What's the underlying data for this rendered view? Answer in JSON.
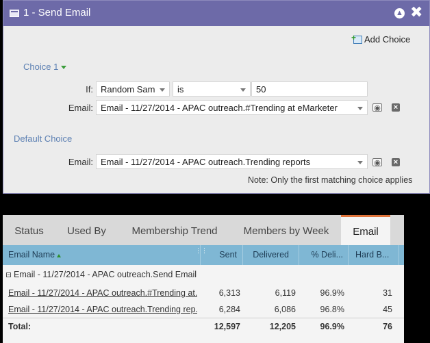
{
  "dialog": {
    "title": "1 - Send Email",
    "add_choice_label": "Add Choice",
    "choice1": {
      "label": "Choice 1",
      "if_label": "If:",
      "condition_field": "Random Sam",
      "operator": "is",
      "value": "50",
      "email_label": "Email:",
      "email_value": "Email - 11/27/2014 - APAC outreach.#Trending at eMarketer"
    },
    "default_choice": {
      "label": "Default Choice",
      "email_label": "Email:",
      "email_value": "Email - 11/27/2014 - APAC outreach.Trending reports"
    },
    "note": "Note: Only the first matching choice applies"
  },
  "panel": {
    "tabs": [
      "Status",
      "Used By",
      "Membership Trend",
      "Members by Week",
      "Email"
    ],
    "active_tab": "Email",
    "columns": [
      "Email Name",
      "Sent",
      "Delivered",
      "% Deli...",
      "Hard B..."
    ],
    "group_label": "Email - 11/27/2014 - APAC outreach.Send Email",
    "rows": [
      {
        "name": "Email - 11/27/2014 - APAC outreach.#Trending at...",
        "sent": "6,313",
        "delivered": "6,119",
        "pct": "96.9%",
        "hard": "31"
      },
      {
        "name": "Email - 11/27/2014 - APAC outreach.Trending rep...",
        "sent": "6,284",
        "delivered": "6,086",
        "pct": "96.8%",
        "hard": "45"
      }
    ],
    "total": {
      "label": "Total:",
      "sent": "12,597",
      "delivered": "12,205",
      "pct": "96.9%",
      "hard": "76"
    }
  }
}
